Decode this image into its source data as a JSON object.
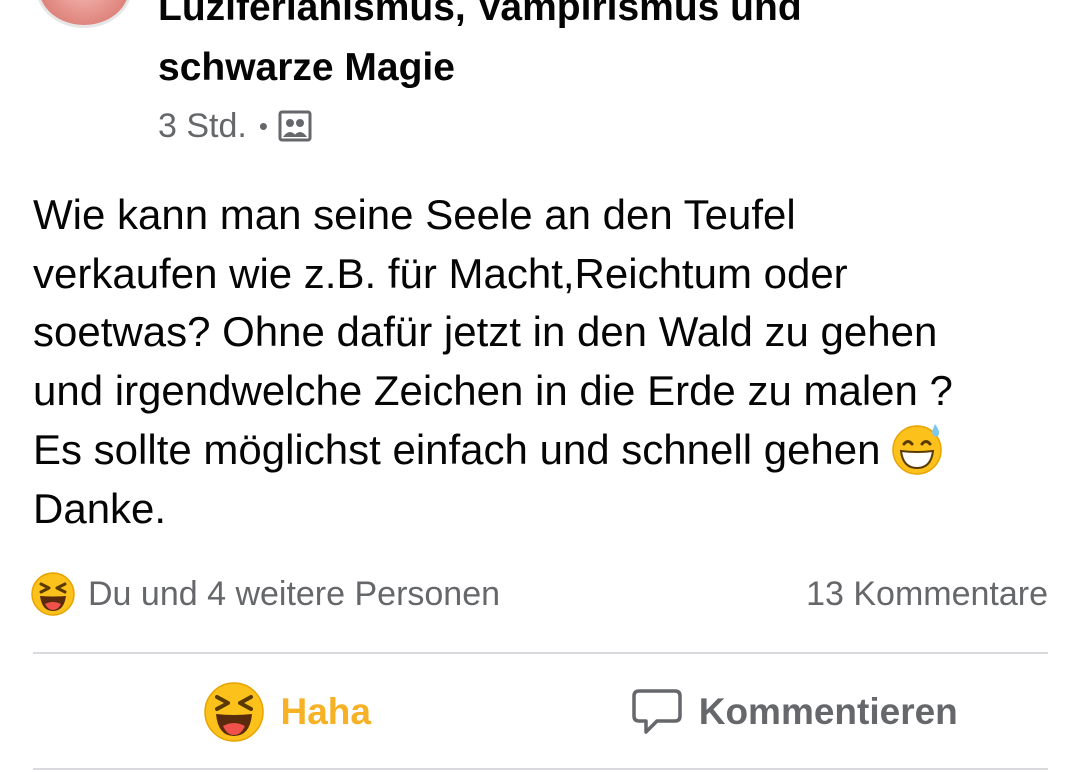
{
  "post": {
    "group_title": "Luziferianismus, Vampirismus und\nschwarze Magie",
    "time": "3 Std.",
    "separator": "•",
    "privacy_icon": "group-members-icon",
    "text": "Wie kann man seine Seele an den Teufel\nverkaufen wie z.B. für Macht,Reichtum oder\nsoetwas? Ohne dafür jetzt in den Wald zu gehen\nund irgendwelche Zeichen in die Erde zu malen ?\nEs sollte möglichst einfach und schnell gehen",
    "text_end": "Danke.",
    "inline_emoji": "grinning-sweat-emoji"
  },
  "reactions": {
    "icon": "haha-reaction-icon",
    "summary": "Du und 4 weitere Personen",
    "comments": "13 Kommentare"
  },
  "actions": {
    "haha_label": "Haha",
    "comment_label": "Kommentieren"
  },
  "colors": {
    "haha": "#f7b125",
    "secondary_text": "#65676b",
    "divider": "#d9dadd"
  }
}
